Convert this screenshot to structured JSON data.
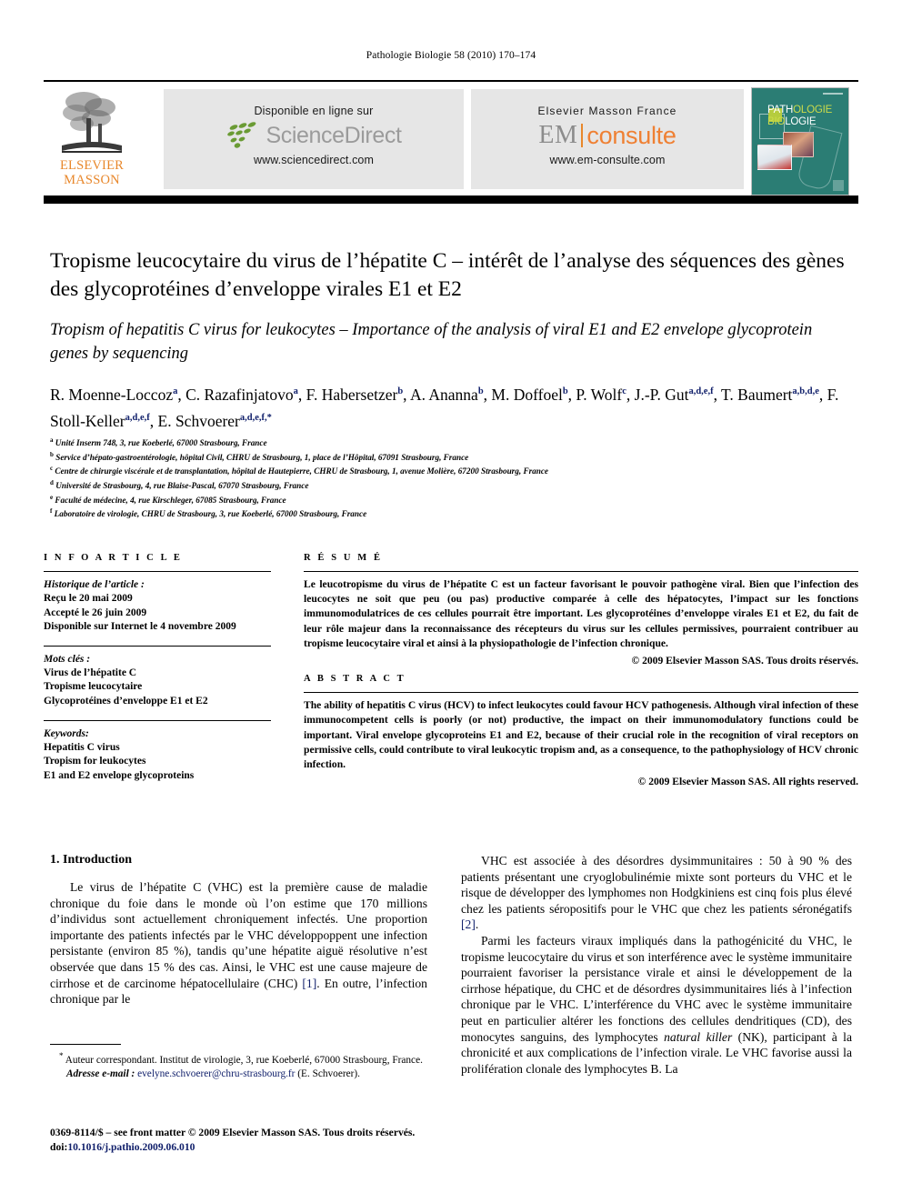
{
  "running_head": "Pathologie Biologie 58 (2010) 170–174",
  "banner": {
    "publisher_logo": {
      "line1": "ELSEVIER",
      "line2": "MASSON",
      "color": "#e8872b",
      "icon": "tree-logo"
    },
    "sciencedirect": {
      "caption": "Disponible en ligne sur",
      "wordmark": "ScienceDirect",
      "url": "www.sciencedirect.com",
      "leaf_color": "#6a9b34",
      "word_color": "#9b9b9b"
    },
    "emconsulte": {
      "caption": "Elsevier Masson France",
      "wordmark_left": "EM",
      "wordmark_right": "consulte",
      "url": "www.em-consulte.com",
      "left_color": "#8c8c8c",
      "right_color": "#ef8033"
    },
    "cover": {
      "line1_a": "PATH",
      "line1_b": "OLOGIE",
      "line2_a": "BIO",
      "line2_b": "LOGIE",
      "background": "#2b7d74",
      "accent": "#cbdb4a"
    }
  },
  "article": {
    "title_fr": "Tropisme leucocytaire du virus de l’hépatite C – intérêt de l’analyse des séquences des gènes des glycoprotéines d’enveloppe virales E1 et E2",
    "title_en": "Tropism of hepatitis C virus for leukocytes – Importance of the analysis of viral E1 and E2 envelope glycoprotein genes by sequencing",
    "authors": [
      {
        "name": "R. Moenne-Loccoz",
        "marks": "a"
      },
      {
        "name": "C. Razafinjatovo",
        "marks": "a"
      },
      {
        "name": "F. Habersetzer",
        "marks": "b"
      },
      {
        "name": "A. Ananna",
        "marks": "b"
      },
      {
        "name": "M. Doffoel",
        "marks": "b"
      },
      {
        "name": "P. Wolf",
        "marks": "c"
      },
      {
        "name": "J.-P. Gut",
        "marks": "a,d,e,f"
      },
      {
        "name": "T. Baumert",
        "marks": "a,b,d,e"
      },
      {
        "name": "F. Stoll-Keller",
        "marks": "a,d,e,f"
      },
      {
        "name": "E. Schvoerer",
        "marks": "a,d,e,f,*"
      }
    ],
    "affiliations": [
      {
        "mark": "a",
        "text": "Unité Inserm 748, 3, rue Koeberlé, 67000 Strasbourg, France"
      },
      {
        "mark": "b",
        "text": "Service d’hépato-gastroentérologie, hôpital Civil, CHRU de Strasbourg, 1, place de l’Hôpital, 67091 Strasbourg, France"
      },
      {
        "mark": "c",
        "text": "Centre de chirurgie viscérale et de transplantation, hôpital de Hautepierre, CHRU de Strasbourg, 1, avenue Molière, 67200 Strasbourg, France"
      },
      {
        "mark": "d",
        "text": "Université de Strasbourg, 4, rue Blaise-Pascal, 67070 Strasbourg, France"
      },
      {
        "mark": "e",
        "text": "Faculté de médecine, 4, rue Kirschleger, 67085 Strasbourg, France"
      },
      {
        "mark": "f",
        "text": "Laboratoire de virologie, CHRU de Strasbourg, 3, rue Koeberlé, 67000 Strasbourg, France"
      }
    ]
  },
  "info": {
    "section_label": "I N F O   A R T I C L E",
    "history_label": "Historique de l’article :",
    "history": [
      "Reçu le 20 mai 2009",
      "Accepté le 26 juin 2009",
      "Disponible sur Internet le 4 novembre 2009"
    ],
    "motscles_label": "Mots clés :",
    "motscles": [
      "Virus de l’hépatite C",
      "Tropisme leucocytaire",
      "Glycoprotéines d’enveloppe E1 et E2"
    ],
    "keywords_label": "Keywords:",
    "keywords": [
      "Hepatitis C virus",
      "Tropism for leukocytes",
      "E1 and E2 envelope glycoproteins"
    ]
  },
  "resume": {
    "label": "R É S U M É",
    "text": "Le leucotropisme du virus de l’hépatite C est un facteur favorisant le pouvoir pathogène viral. Bien que l’infection des leucocytes ne soit que peu (ou pas) productive comparée à celle des hépatocytes, l’impact sur les fonctions immunomodulatrices de ces cellules pourrait être important. Les glycoprotéines d’enveloppe virales E1 et E2, du fait de leur rôle majeur dans la reconnaissance des récepteurs du virus sur les cellules permissives, pourraient contribuer au tropisme leucocytaire viral et ainsi à la physiopathologie de l’infection chronique.",
    "copyright": "© 2009 Elsevier Masson SAS. Tous droits réservés."
  },
  "abstract": {
    "label": "A B S T R A C T",
    "text": "The ability of hepatitis C virus (HCV) to infect leukocytes could favour HCV pathogenesis. Although viral infection of these immunocompetent cells is poorly (or not) productive, the impact on their immunomodulatory functions could be important. Viral envelope glycoproteins E1 and E2, because of their crucial role in the recognition of viral receptors on permissive cells, could contribute to viral leukocytic tropism and, as a consequence, to the pathophysiology of HCV chronic infection.",
    "copyright": "© 2009 Elsevier Masson SAS. All rights reserved."
  },
  "body": {
    "section_heading": "1. Introduction",
    "left_paragraph_pre": "Le virus de l’hépatite C (VHC) est la première cause de maladie chronique du foie dans le monde où l’on estime que 170 millions d’individus sont actuellement chroniquement infectés. Une proportion importante des patients infectés par le VHC développoppent une infection persistante (environ 85 %), tandis qu’une hépatite aiguë résolutive n’est observée que dans 15 % des cas. Ainsi, le VHC est une cause majeure de cirrhose et de carcinome hépatocellulaire (CHC) ",
    "left_citation": "[1]",
    "left_paragraph_post": ". En outre, l’infection chronique par le",
    "right_paragraph1_pre": "VHC est associée à des désordres dysimmunitaires : 50 à 90 % des patients présentant une cryoglobulinémie mixte sont porteurs du VHC et le risque de développer des lymphomes non Hodgkiniens est cinq fois plus élevé chez les patients séropositifs pour le VHC que chez les patients séronégatifs ",
    "right_citation1": "[2]",
    "right_paragraph1_post": ".",
    "right_paragraph2_pre": "Parmi les facteurs viraux impliqués dans la pathogénicité du VHC, le tropisme leucocytaire du virus et son interférence avec le système immunitaire pourraient favoriser la persistance virale et ainsi le développement de la cirrhose hépatique, du CHC et de désordres dysimmunitaires liés à l’infection chronique par le VHC. L’interférence du VHC avec le système immunitaire peut en particulier altérer les fonctions des cellules dendritiques (CD), des monocytes sanguins, des lymphocytes ",
    "right_paragraph2_italic": "natural killer",
    "right_paragraph2_post": " (NK), participant à la chronicité et aux complications de l’infection virale. Le VHC favorise aussi la prolifération clonale des lymphocytes B. La"
  },
  "footnotes": {
    "corresponding_mark": "*",
    "corresponding": "Auteur correspondant. Institut de virologie, 3, rue Koeberlé, 67000 Strasbourg, France.",
    "email_label": "Adresse e-mail :",
    "email": "evelyne.schvoerer@chru-strasbourg.fr",
    "email_suffix": "(E. Schvoerer).",
    "imprint_line1": "0369-8114/$ – see front matter © 2009 Elsevier Masson SAS. Tous droits réservés.",
    "doi_prefix": "doi:",
    "doi": "10.1016/j.pathio.2009.06.010"
  }
}
